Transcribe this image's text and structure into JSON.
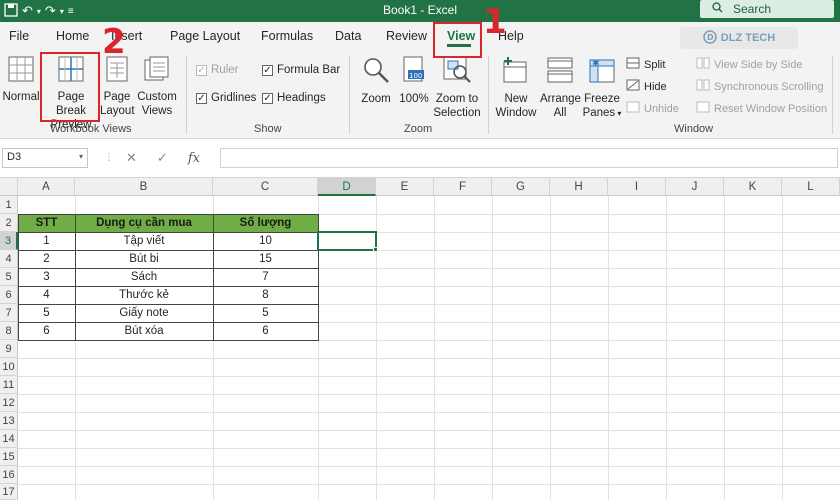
{
  "app": {
    "window_title": "Book1  -  Excel",
    "search_label": "Search"
  },
  "tabs": [
    "File",
    "Home",
    "Insert",
    "Page Layout",
    "Formulas",
    "Data",
    "Review",
    "View",
    "Help"
  ],
  "brand_text": "DLZ TECH",
  "ribbon": {
    "workbook_views": {
      "label": "Workbook Views",
      "normal": "Normal",
      "page_break_line1": "Page Break",
      "page_break_line2": "Preview",
      "page_layout_line1": "Page",
      "page_layout_line2": "Layout",
      "custom_views_line1": "Custom",
      "custom_views_line2": "Views"
    },
    "show": {
      "label": "Show",
      "ruler": "Ruler",
      "formula_bar": "Formula Bar",
      "gridlines": "Gridlines",
      "headings": "Headings"
    },
    "zoom": {
      "label": "Zoom",
      "zoom": "Zoom",
      "hundred": "100%",
      "zoom_to_sel_line1": "Zoom to",
      "zoom_to_sel_line2": "Selection"
    },
    "window": {
      "label": "Window",
      "new_window_line1": "New",
      "new_window_line2": "Window",
      "arrange_line1": "Arrange",
      "arrange_line2": "All",
      "freeze_line1": "Freeze",
      "freeze_line2": "Panes",
      "split": "Split",
      "hide": "Hide",
      "unhide": "Unhide",
      "view_side": "View Side by Side",
      "sync_scroll": "Synchronous Scrolling",
      "reset_pos": "Reset Window Position"
    }
  },
  "formula_bar": {
    "name_box": "D3",
    "fx": "fx",
    "cancel": "✕",
    "enter": "✓"
  },
  "columns": [
    "A",
    "B",
    "C",
    "D",
    "E",
    "F",
    "G",
    "H",
    "I",
    "J",
    "K",
    "L"
  ],
  "rows": [
    "1",
    "2",
    "3",
    "4",
    "5",
    "6",
    "7",
    "8",
    "9",
    "10",
    "11",
    "12",
    "13",
    "14",
    "15",
    "16",
    "17"
  ],
  "table": {
    "headers": [
      "STT",
      "Dụng cụ cần mua",
      "Số lượng"
    ],
    "rows": [
      [
        "1",
        "Tập viết",
        "10"
      ],
      [
        "2",
        "Bút bi",
        "15"
      ],
      [
        "3",
        "Sách",
        "7"
      ],
      [
        "4",
        "Thước kẻ",
        "8"
      ],
      [
        "5",
        "Giấy note",
        "5"
      ],
      [
        "6",
        "Bút xóa",
        "6"
      ]
    ]
  },
  "annotations": {
    "step1": "1",
    "step2": "2"
  },
  "colors": {
    "excel_green": "#217346",
    "header_fill": "#70ad47",
    "annotation_red": "#d9262c"
  }
}
